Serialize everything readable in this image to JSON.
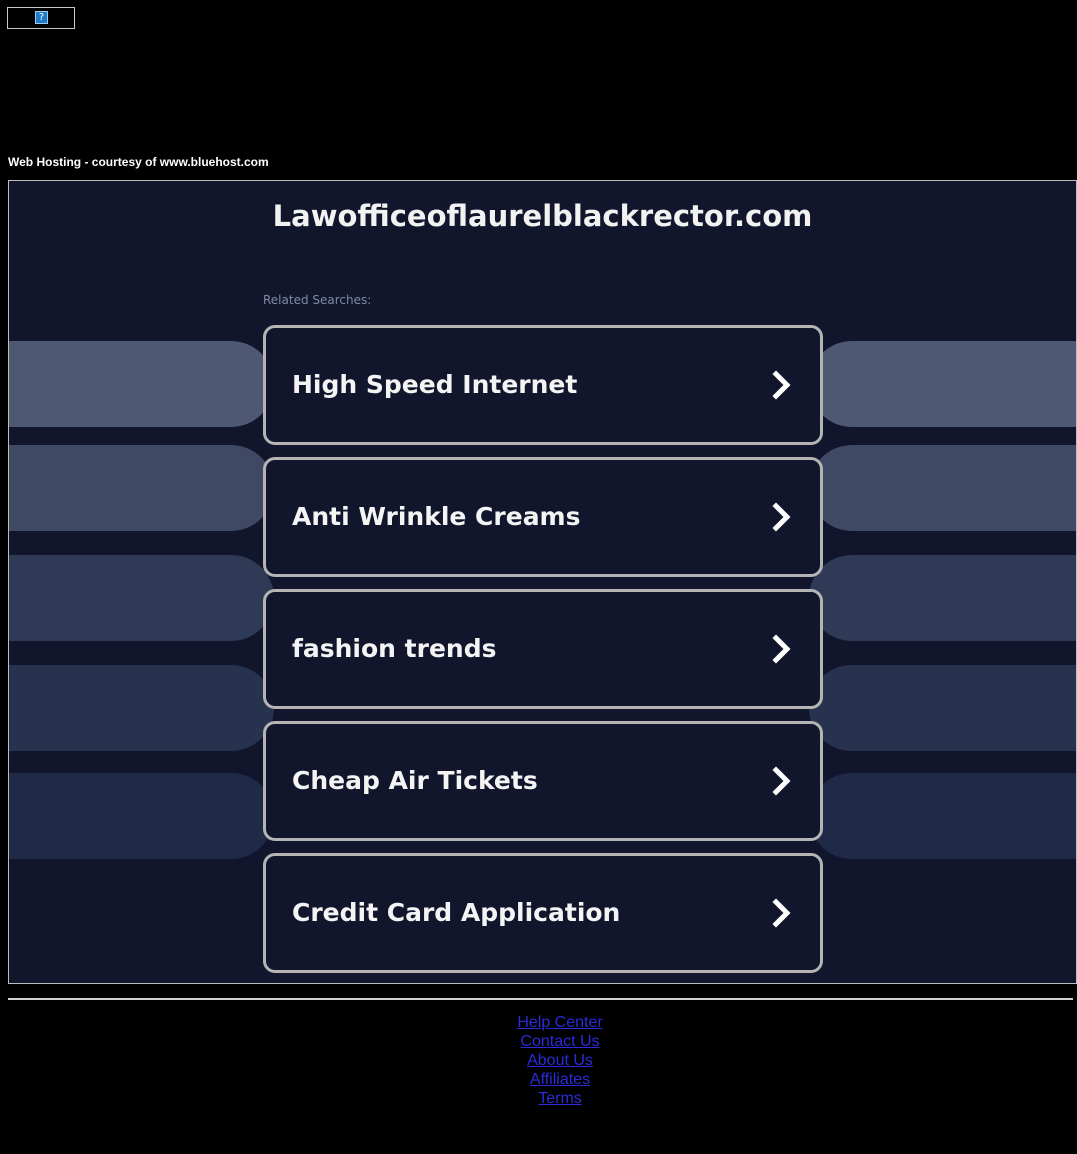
{
  "header": {
    "broken_image_glyph": "?",
    "hosting_text": "Web Hosting - courtesy of www.bluehost.com"
  },
  "main": {
    "domain": "Lawofficeoflaurelblackrector.com",
    "related_label": "Related Searches:",
    "searches": [
      {
        "label": "High Speed Internet"
      },
      {
        "label": "Anti Wrinkle Creams"
      },
      {
        "label": "fashion trends"
      },
      {
        "label": "Cheap Air Tickets"
      },
      {
        "label": "Credit Card Application"
      }
    ],
    "chevron_icon": "chevron-right-icon"
  },
  "footer": {
    "links": [
      {
        "label": "Help Center"
      },
      {
        "label": "Contact Us"
      },
      {
        "label": "About Us"
      },
      {
        "label": "Affiliates"
      },
      {
        "label": "Terms"
      }
    ]
  },
  "colors": {
    "page_background": "#000000",
    "frame_background": "#11162c",
    "card_border": "#b4b4b4",
    "footer_link": "#2b2bd9"
  }
}
